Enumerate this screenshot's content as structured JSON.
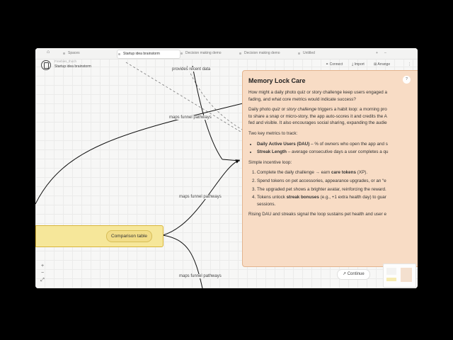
{
  "tabs": [
    {
      "label": "Spaces",
      "active": false
    },
    {
      "label": "Startup idea brainstorm",
      "active": true
    },
    {
      "label": "Decision making demo",
      "active": false
    },
    {
      "label": "Decision making demo",
      "active": false
    },
    {
      "label": "Untitled",
      "active": false
    }
  ],
  "tab_controls": {
    "add": "+",
    "menu": "–"
  },
  "header": {
    "breadcrumb_parent": "Freebies_thoch",
    "breadcrumb_current": "Startup idea brainstorm",
    "connect": "Connect",
    "import": "Import",
    "arrange": "Arrange",
    "more": "⋮"
  },
  "canvas": {
    "edge_label_top": "provides recent data",
    "edge_label_1": "maps funnel pathways",
    "edge_label_2": "maps funnel pathways",
    "edge_label_3": "maps funnel pathways",
    "yellow_node_chip": "Comparison table"
  },
  "panel": {
    "title": "Memory Lock Care",
    "help": "?",
    "q1": "How might a daily photo quiz or story challenge keep users engaged a",
    "q2": "fading, and what core metrics would indicate success?",
    "p1a": "Daily photo ",
    "p1b": "quiz",
    "p1c": " or ",
    "p1d": "story challenge",
    "p1e": " triggers a habit loop: a morning pro",
    "p1f": "to share a snap or micro-story, the app auto-scores it and credits the A",
    "p1g": "fed and visible. It also encourages social sharing, expanding the audie",
    "metrics_intro": "Two key metrics to track:",
    "m1_bold": "Daily Active Users (DAU)",
    "m1_rest": " – % of owners who open the app and s",
    "m2_bold": "Streak Length",
    "m2_rest": " – average consecutive days a user completes a qu",
    "incentive_intro": "Simple incentive loop:",
    "s1_a": "Complete the daily challenge → earn ",
    "s1_b": "care tokens",
    "s1_c": " (XP).",
    "s2": "Spend tokens on pet accessories, appearance upgrades, or an “e",
    "s3": "The upgraded pet shows a brighter avatar, reinforcing the reward.",
    "s4_a": "Tokens unlock ",
    "s4_b": "streak bonuses",
    "s4_c": " (e.g., +1 extra health day) to guar",
    "s4_d": "sessions.",
    "closing": "Rising DAU and streaks signal the loop sustains pet health and user e"
  },
  "zoom": {
    "in": "+",
    "out": "−",
    "fit": "⤢"
  },
  "continue_label": "Continue",
  "colors": {
    "panel_bg": "#f8dcc5",
    "panel_border": "#e3b48e",
    "yellow_node": "#f6e79a",
    "canvas_bg": "#f7f7f6"
  }
}
